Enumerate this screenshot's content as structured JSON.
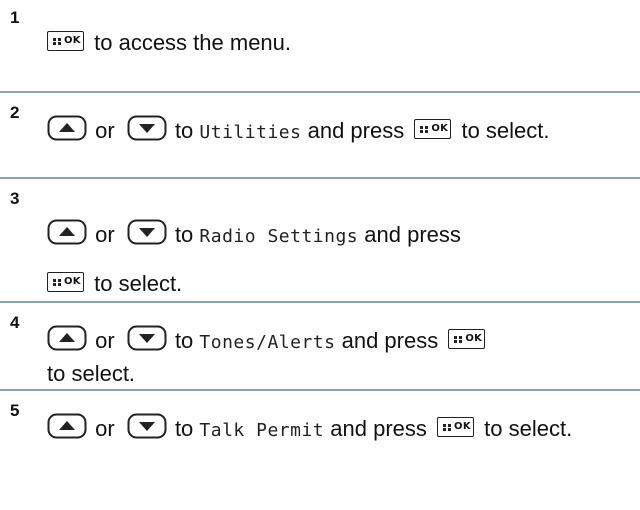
{
  "steps": [
    {
      "number": "1",
      "text_after_ok": "to access the menu."
    },
    {
      "number": "2",
      "or": "or",
      "to": "to",
      "item": "Utilities",
      "and_press": "and press",
      "tail": "to select."
    },
    {
      "number": "3",
      "or": "or",
      "to": "to",
      "item": "Radio Settings",
      "and_press": "and press",
      "tail": "to select."
    },
    {
      "number": "4",
      "or": "or",
      "to": "to",
      "item": "Tones/Alerts",
      "and_press": "and press",
      "tail": "to select."
    },
    {
      "number": "5",
      "or": "or",
      "to": "to",
      "item": "Talk Permit",
      "and_press": "and press",
      "tail": "to select."
    }
  ],
  "icons": {
    "ok_label": "OK",
    "menu_ok_key": "menu-ok-key-icon",
    "up_key": "up-arrow-key-icon",
    "down_key": "down-arrow-key-icon"
  },
  "colors": {
    "separator": "#8aa3b7",
    "text": "#111111"
  }
}
